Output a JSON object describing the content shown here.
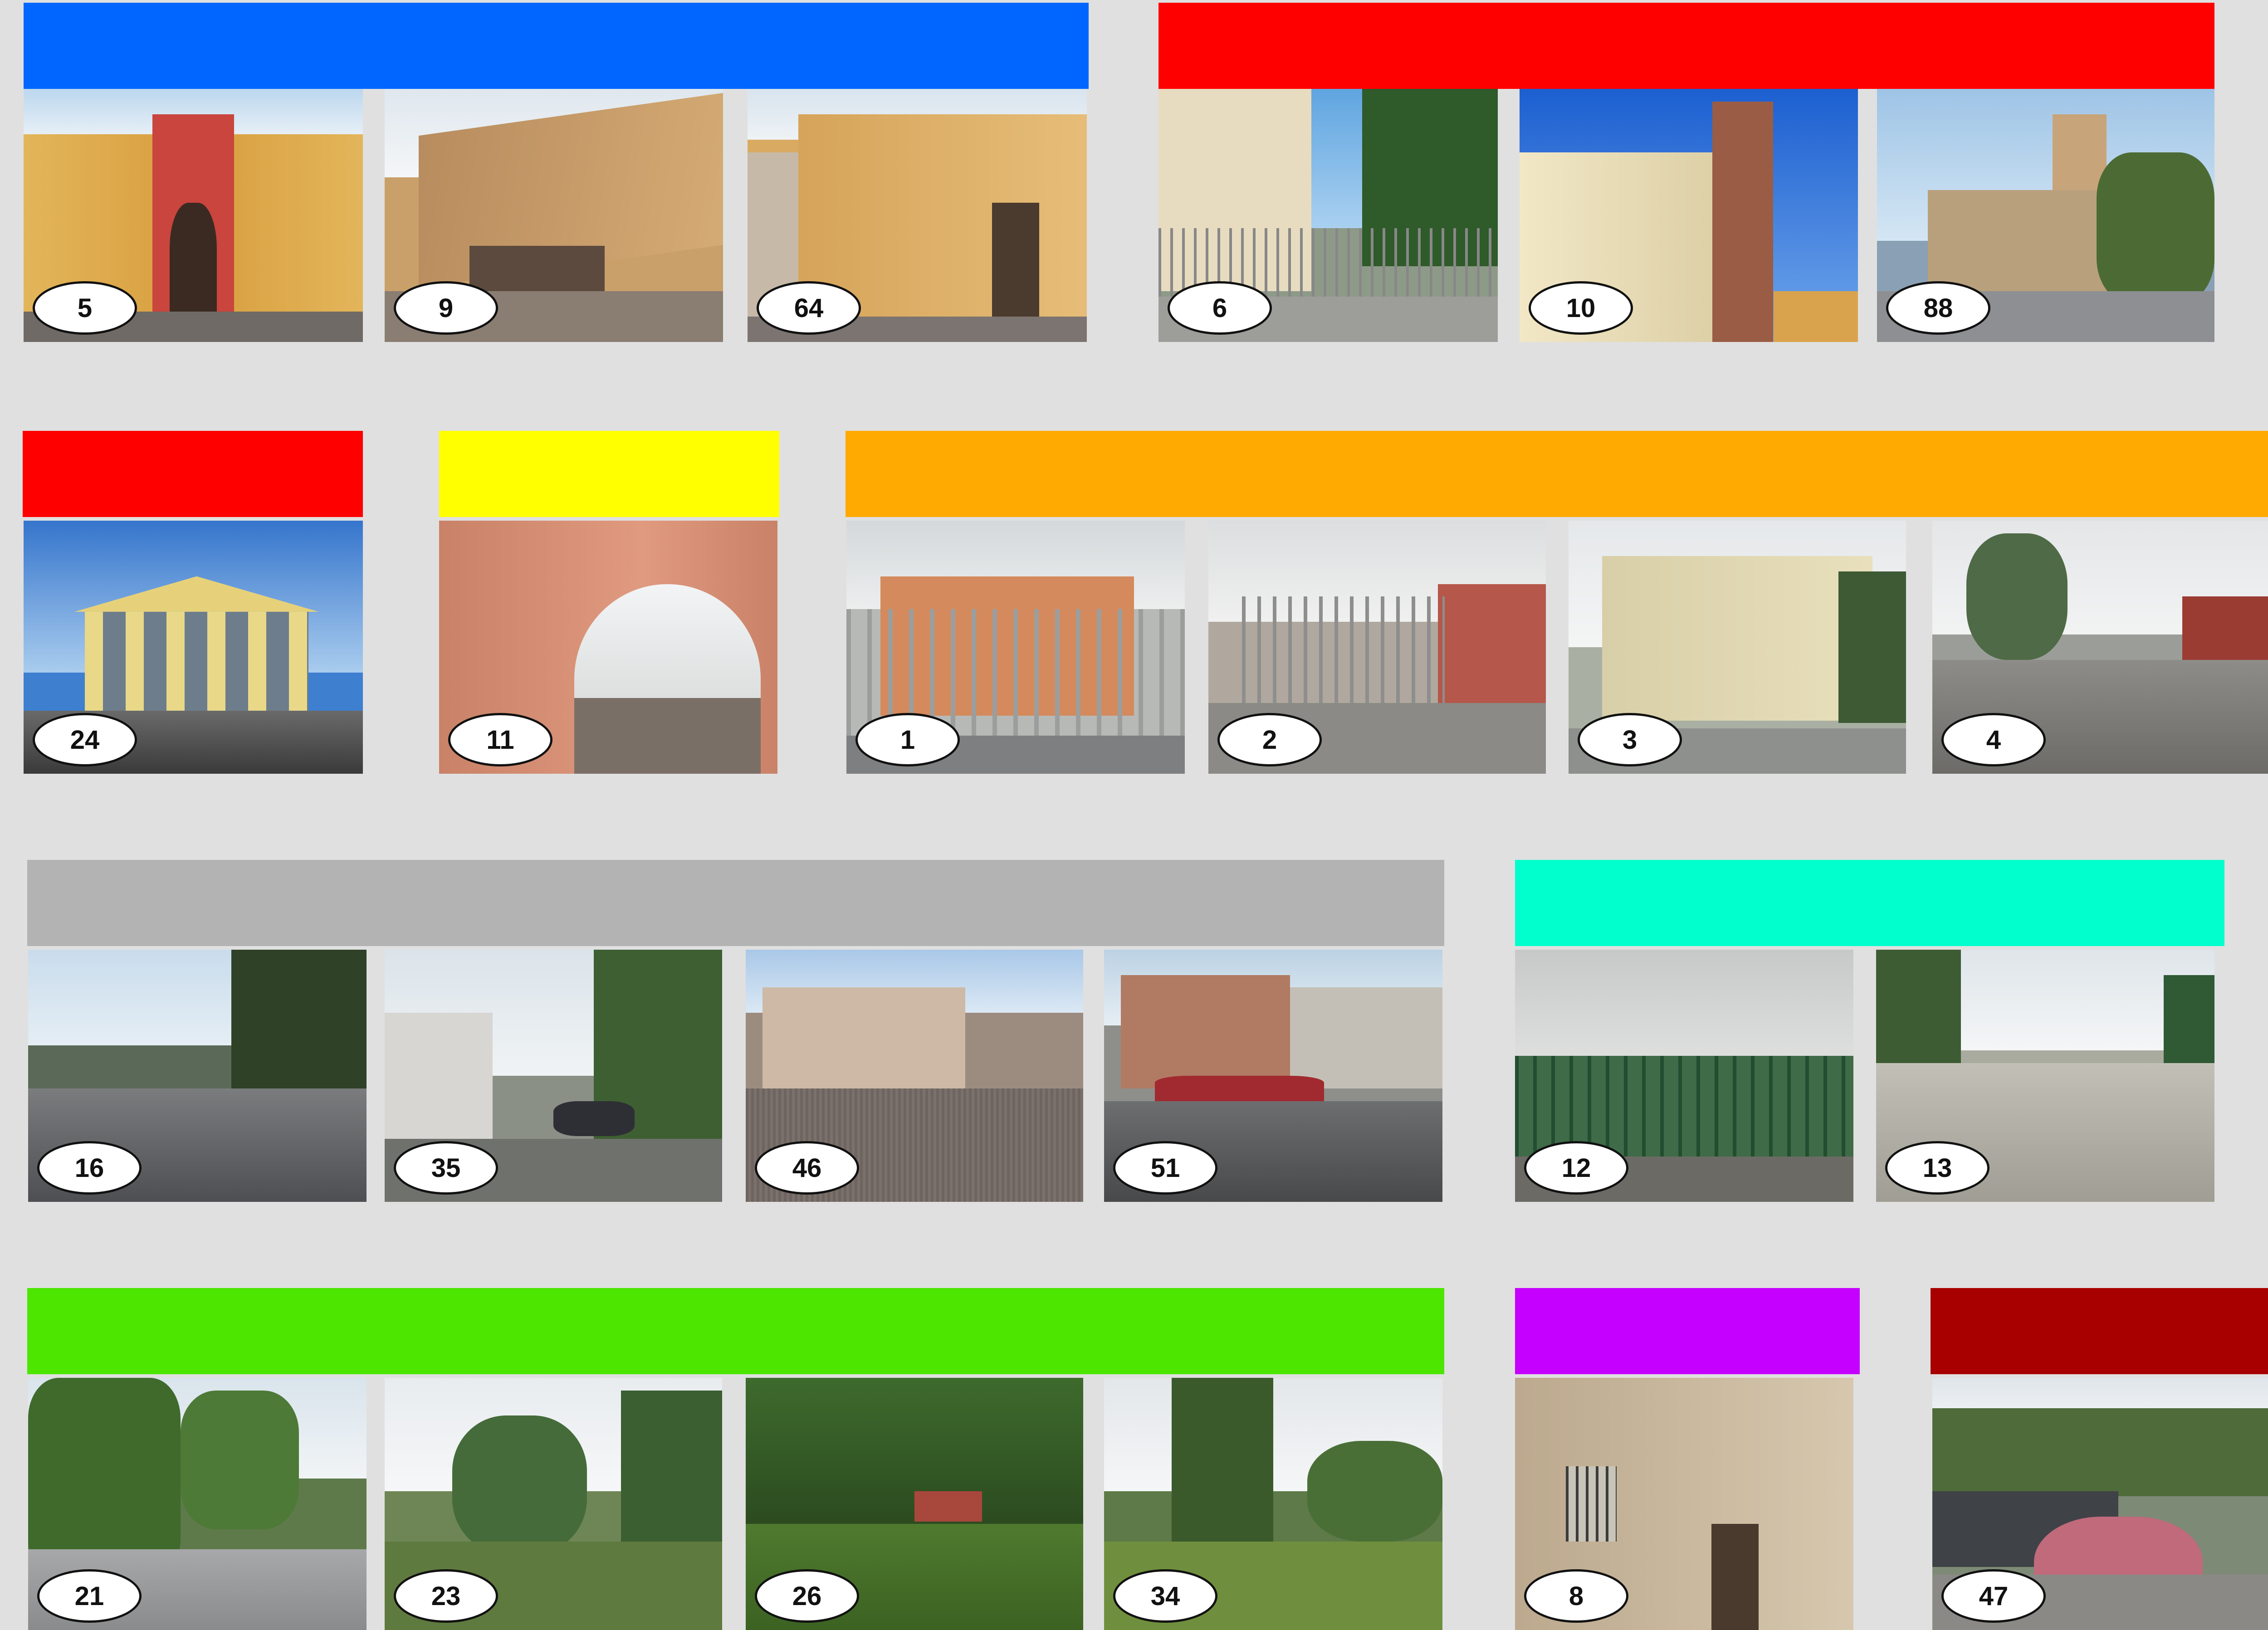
{
  "groups": [
    {
      "color": "#0066ff",
      "photos": [
        {
          "num": "5"
        },
        {
          "num": "9"
        },
        {
          "num": "64"
        }
      ]
    },
    {
      "color": "#ff0000",
      "photos": [
        {
          "num": "6"
        },
        {
          "num": "10"
        },
        {
          "num": "88"
        }
      ]
    },
    {
      "color": "#ff0000",
      "photos": [
        {
          "num": "24"
        }
      ]
    },
    {
      "color": "#ffff00",
      "photos": [
        {
          "num": "11"
        }
      ]
    },
    {
      "color": "#ffaa00",
      "photos": [
        {
          "num": "1"
        },
        {
          "num": "2"
        },
        {
          "num": "3"
        },
        {
          "num": "4"
        }
      ]
    },
    {
      "color": "#b3b3b3",
      "photos": [
        {
          "num": "16"
        },
        {
          "num": "35"
        },
        {
          "num": "46"
        },
        {
          "num": "51"
        }
      ]
    },
    {
      "color": "#00ffcc",
      "photos": [
        {
          "num": "12"
        },
        {
          "num": "13"
        }
      ]
    },
    {
      "color": "#4ce600",
      "photos": [
        {
          "num": "21"
        },
        {
          "num": "23"
        },
        {
          "num": "26"
        },
        {
          "num": "34"
        }
      ]
    },
    {
      "color": "#c500ff",
      "photos": [
        {
          "num": "8"
        }
      ]
    },
    {
      "color": "#a80000",
      "photos": [
        {
          "num": "47"
        }
      ]
    }
  ]
}
